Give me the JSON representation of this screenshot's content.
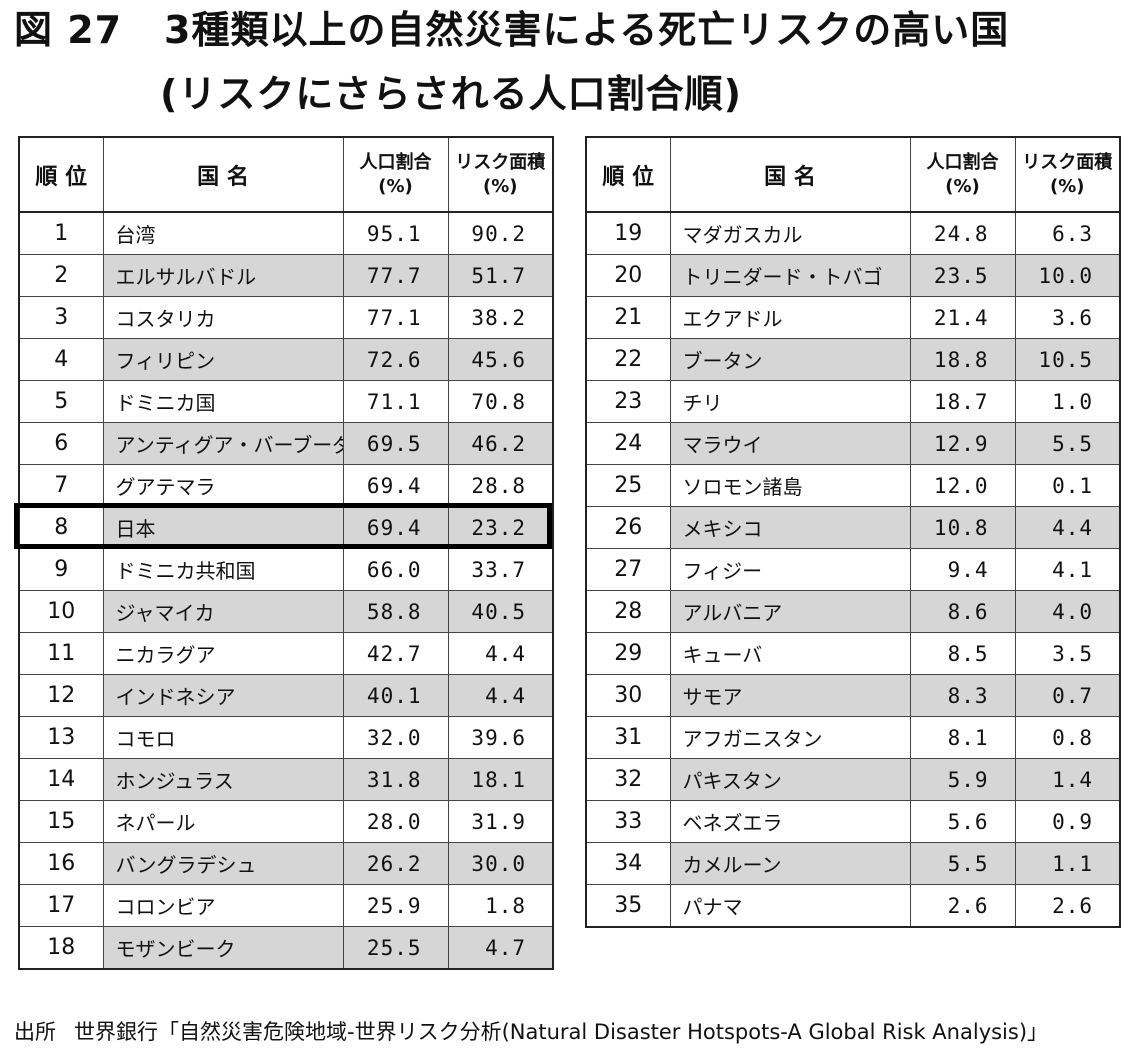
{
  "title": {
    "figure": "図 27",
    "text": "3種類以上の自然災害による死亡リスクの高い国",
    "sub": "(リスクにさらされる人口割合順)"
  },
  "headers": {
    "rank": "順 位",
    "name": "国 名",
    "pop": "人口割合",
    "pop_unit": "(%)",
    "area": "リスク面積",
    "area_unit": "(%)"
  },
  "left_rows": [
    {
      "rank": "1",
      "name": "台湾",
      "pop": "95.1",
      "area": "90.2"
    },
    {
      "rank": "2",
      "name": "エルサルバドル",
      "pop": "77.7",
      "area": "51.7"
    },
    {
      "rank": "3",
      "name": "コスタリカ",
      "pop": "77.1",
      "area": "38.2"
    },
    {
      "rank": "4",
      "name": "フィリピン",
      "pop": "72.6",
      "area": "45.6"
    },
    {
      "rank": "5",
      "name": "ドミニカ国",
      "pop": "71.1",
      "area": "70.8"
    },
    {
      "rank": "6",
      "name": "アンティグア・バーブーダ",
      "pop": "69.5",
      "area": "46.2"
    },
    {
      "rank": "7",
      "name": "グアテマラ",
      "pop": "69.4",
      "area": "28.8"
    },
    {
      "rank": "8",
      "name": "日本",
      "pop": "69.4",
      "area": "23.2"
    },
    {
      "rank": "9",
      "name": "ドミニカ共和国",
      "pop": "66.0",
      "area": "33.7"
    },
    {
      "rank": "10",
      "name": "ジャマイカ",
      "pop": "58.8",
      "area": "40.5"
    },
    {
      "rank": "11",
      "name": "ニカラグア",
      "pop": "42.7",
      "area": "4.4"
    },
    {
      "rank": "12",
      "name": "インドネシア",
      "pop": "40.1",
      "area": "4.4"
    },
    {
      "rank": "13",
      "name": "コモロ",
      "pop": "32.0",
      "area": "39.6"
    },
    {
      "rank": "14",
      "name": "ホンジュラス",
      "pop": "31.8",
      "area": "18.1"
    },
    {
      "rank": "15",
      "name": "ネパール",
      "pop": "28.0",
      "area": "31.9"
    },
    {
      "rank": "16",
      "name": "バングラデシュ",
      "pop": "26.2",
      "area": "30.0"
    },
    {
      "rank": "17",
      "name": "コロンビア",
      "pop": "25.9",
      "area": "1.8"
    },
    {
      "rank": "18",
      "name": "モザンビーク",
      "pop": "25.5",
      "area": "4.7"
    }
  ],
  "right_rows": [
    {
      "rank": "19",
      "name": "マダガスカル",
      "pop": "24.8",
      "area": "6.3"
    },
    {
      "rank": "20",
      "name": "トリニダード・トバゴ",
      "pop": "23.5",
      "area": "10.0"
    },
    {
      "rank": "21",
      "name": "エクアドル",
      "pop": "21.4",
      "area": "3.6"
    },
    {
      "rank": "22",
      "name": "ブータン",
      "pop": "18.8",
      "area": "10.5"
    },
    {
      "rank": "23",
      "name": "チリ",
      "pop": "18.7",
      "area": "1.0"
    },
    {
      "rank": "24",
      "name": "マラウイ",
      "pop": "12.9",
      "area": "5.5"
    },
    {
      "rank": "25",
      "name": "ソロモン諸島",
      "pop": "12.0",
      "area": "0.1"
    },
    {
      "rank": "26",
      "name": "メキシコ",
      "pop": "10.8",
      "area": "4.4"
    },
    {
      "rank": "27",
      "name": "フィジー",
      "pop": "9.4",
      "area": "4.1"
    },
    {
      "rank": "28",
      "name": "アルバニア",
      "pop": "8.6",
      "area": "4.0"
    },
    {
      "rank": "29",
      "name": "キューバ",
      "pop": "8.5",
      "area": "3.5"
    },
    {
      "rank": "30",
      "name": "サモア",
      "pop": "8.3",
      "area": "0.7"
    },
    {
      "rank": "31",
      "name": "アフガニスタン",
      "pop": "8.1",
      "area": "0.8"
    },
    {
      "rank": "32",
      "name": "パキスタン",
      "pop": "5.9",
      "area": "1.4"
    },
    {
      "rank": "33",
      "name": "ベネズエラ",
      "pop": "5.6",
      "area": "0.9"
    },
    {
      "rank": "34",
      "name": "カメルーン",
      "pop": "5.5",
      "area": "1.1"
    },
    {
      "rank": "35",
      "name": "パナマ",
      "pop": "2.6",
      "area": "2.6"
    }
  ],
  "highlight_rank": "8",
  "source": {
    "label": "出所",
    "text": "世界銀行「自然災害危険地域-世界リスク分析(Natural Disaster Hotspots-A Global Risk Analysis)」"
  }
}
